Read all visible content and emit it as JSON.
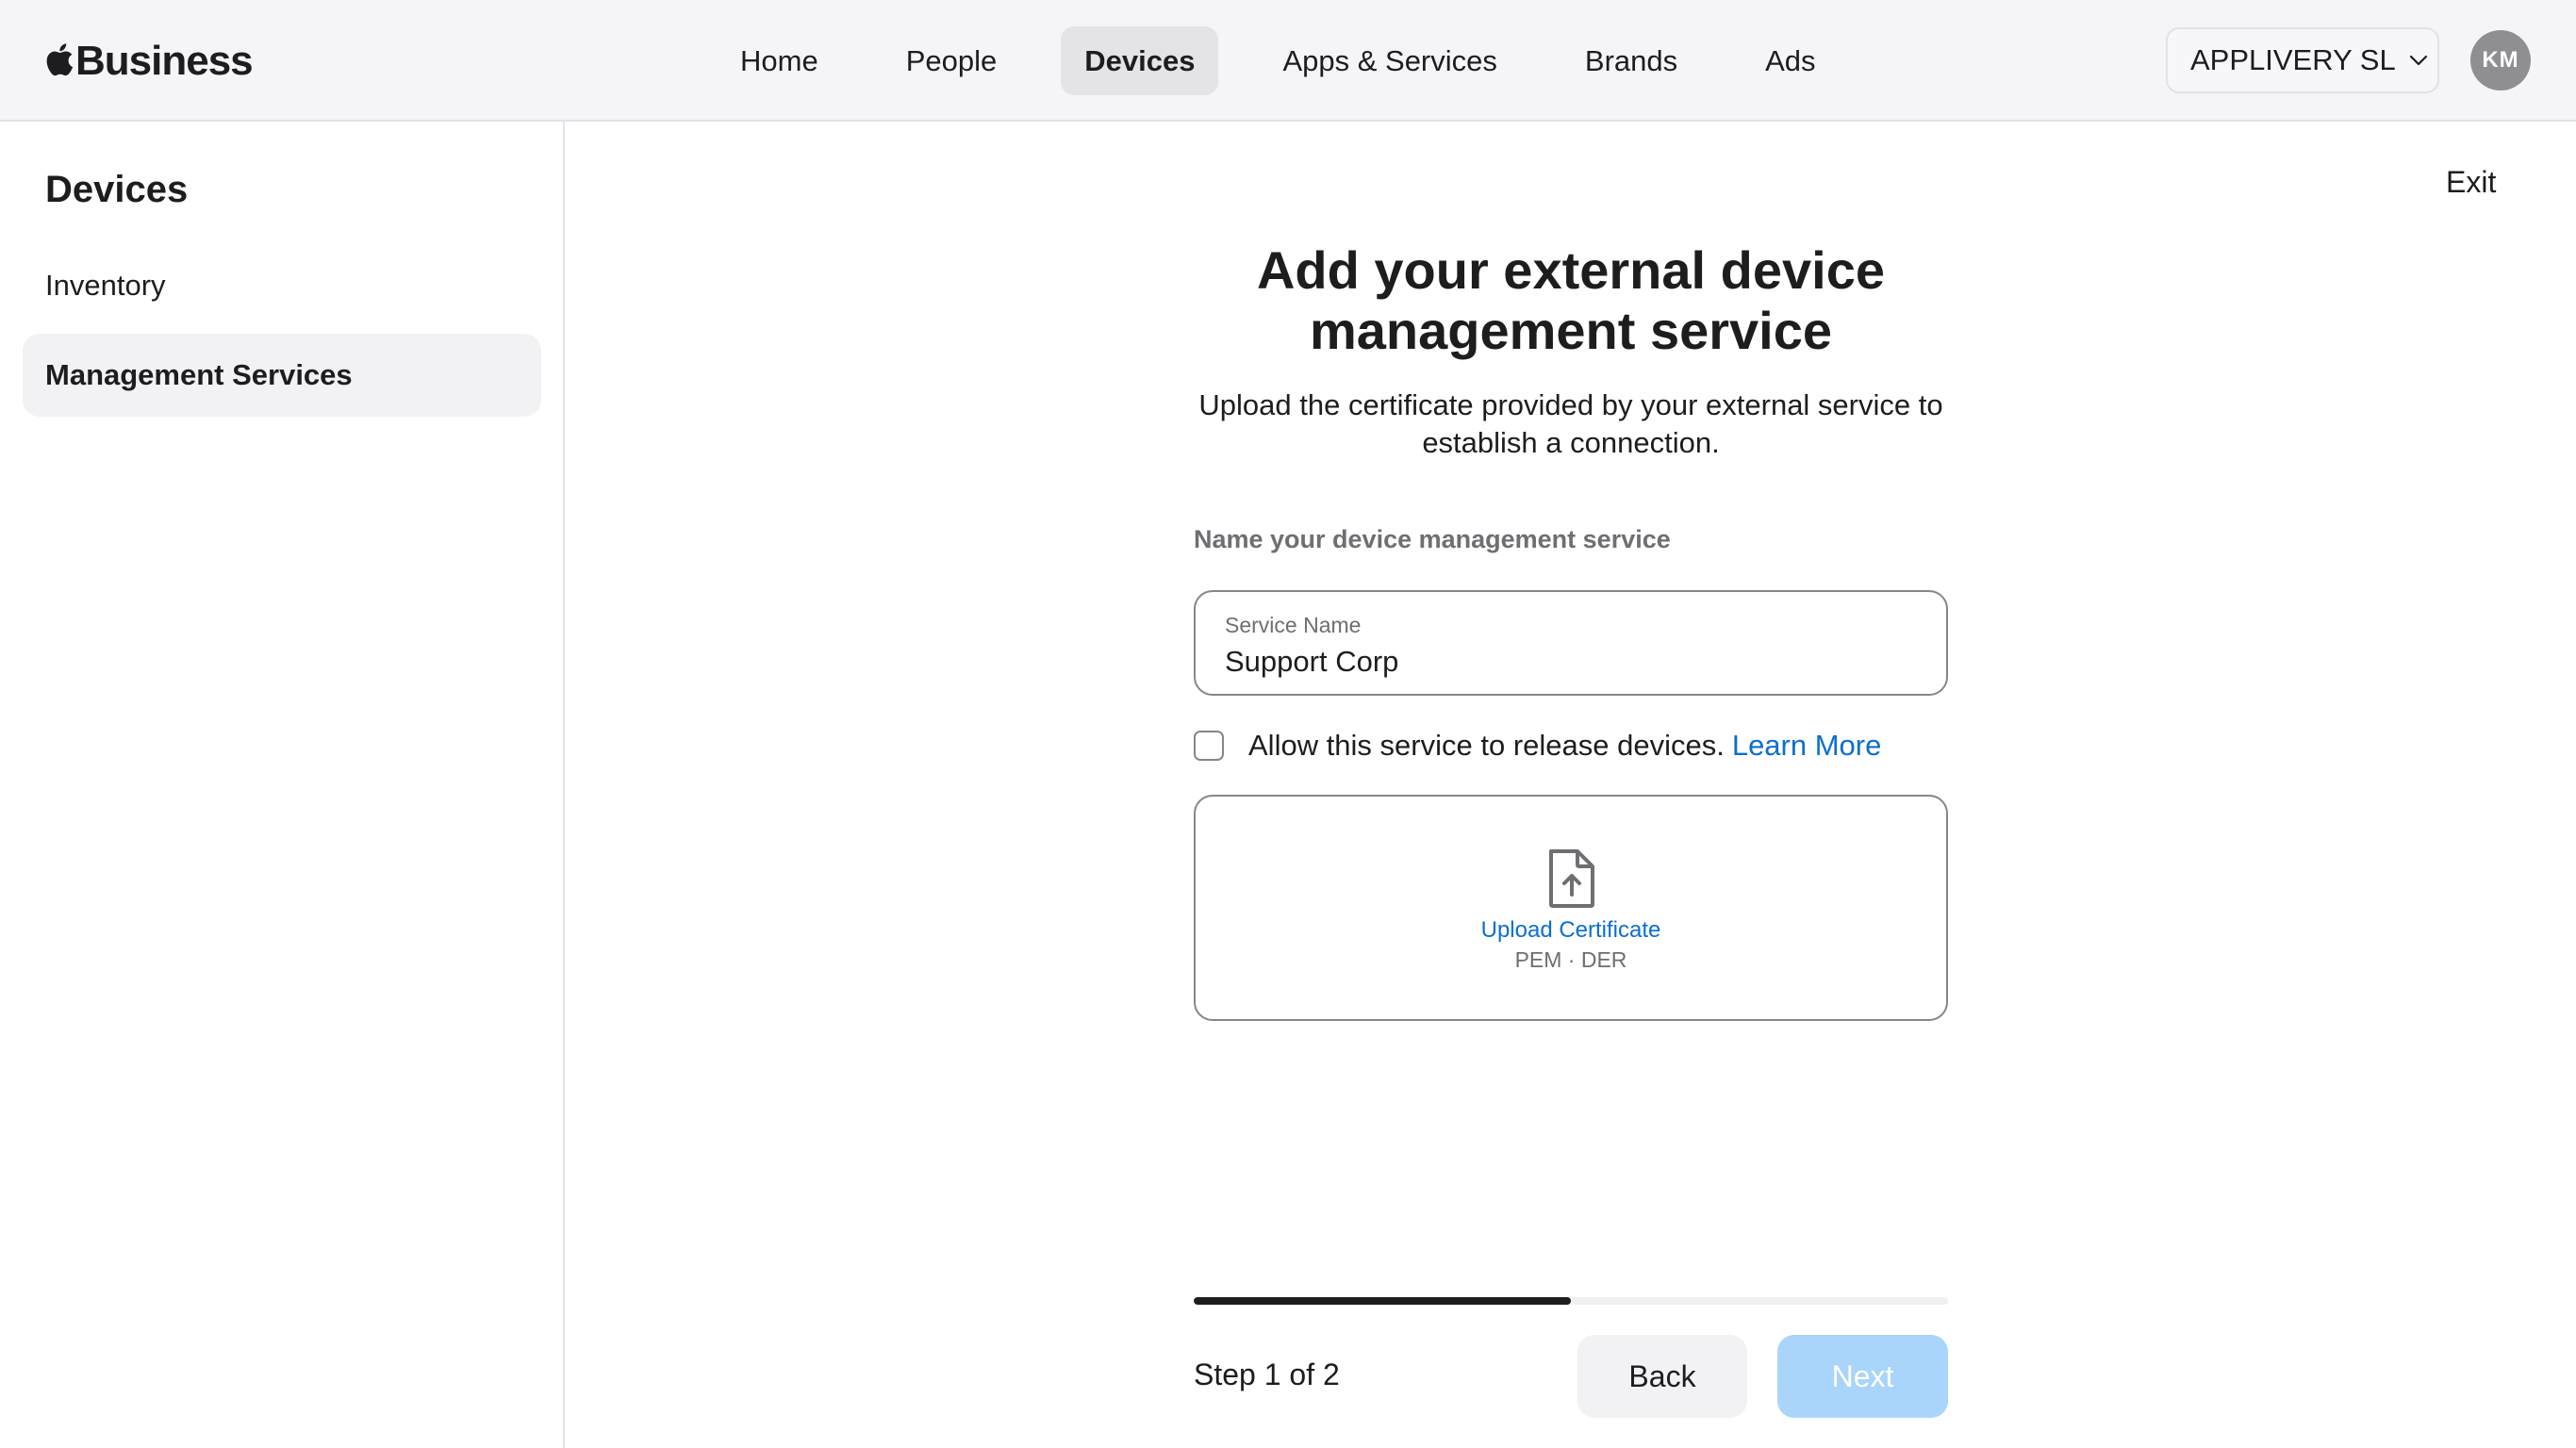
{
  "header": {
    "brand": "Business",
    "nav": [
      {
        "label": "Home",
        "active": false
      },
      {
        "label": "People",
        "active": false
      },
      {
        "label": "Devices",
        "active": true
      },
      {
        "label": "Apps & Services",
        "active": false
      },
      {
        "label": "Brands",
        "active": false
      },
      {
        "label": "Ads",
        "active": false
      }
    ],
    "org": "APPLIVERY SL",
    "avatar_initials": "KM"
  },
  "sidebar": {
    "title": "Devices",
    "items": [
      {
        "label": "Inventory",
        "selected": false
      },
      {
        "label": "Management Services",
        "selected": true
      }
    ]
  },
  "main": {
    "exit": "Exit",
    "title": "Add your external device management service",
    "subtitle": "Upload the certificate provided by your external service to establish a connection.",
    "name_section_label": "Name your device management service",
    "service_field": {
      "label": "Service Name",
      "value": "Support Corp"
    },
    "release_checkbox": {
      "checked": false,
      "text": "Allow this service to release devices.",
      "link": "Learn More"
    },
    "upload": {
      "label": "Upload Certificate",
      "formats": "PEM · DER",
      "icon": "document-upload-icon"
    },
    "progress": {
      "fraction": 0.5,
      "step_text": "Step 1 of 2"
    },
    "buttons": {
      "back": "Back",
      "next": "Next",
      "next_enabled": false
    }
  },
  "colors": {
    "accent": "#0a6fd0",
    "next_disabled": "#a9d5fb",
    "topbar_bg": "#f5f5f7",
    "text": "#1d1d1f"
  }
}
